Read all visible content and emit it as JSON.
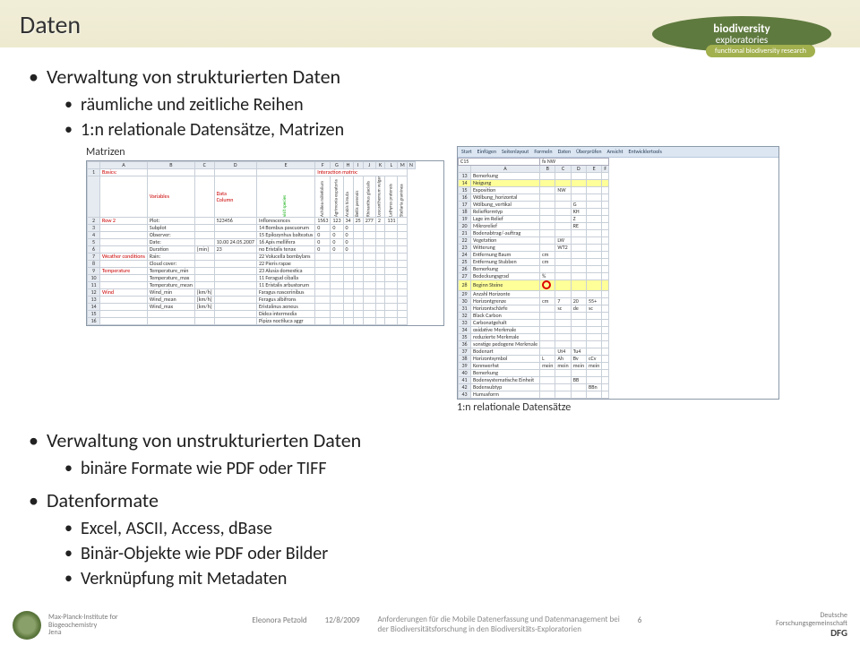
{
  "title": "Daten",
  "logo": {
    "line1": "biodiversity",
    "line2": "exploratories",
    "sub": "functional biodiversity research"
  },
  "bullets": {
    "b1": "Verwaltung von strukturierten Daten",
    "b1a": "räumliche und zeitliche Reihen",
    "b1b": "1:n relationale Datensätze, Matrizen",
    "b2": "Verwaltung von unstrukturierten Daten",
    "b2a": "binäre Formate wie PDF oder TIFF",
    "b3": "Datenformate",
    "b3a": "Excel, ASCII, Access, dBase",
    "b3b": "Binär-Objekte wie PDF oder Bilder",
    "b3c": "Verknüpfung mit Metadaten"
  },
  "fig1": {
    "caption": "Matrizen",
    "label_basics": "Basics:",
    "label_variables": "Variables",
    "label_data_col": "Data Column",
    "label_interaction": "Interaction matrix:",
    "side_label": "visit species",
    "rows_left": [
      "Row 2",
      "",
      "",
      "",
      "",
      "Weather conditions",
      "",
      "Temperature",
      "",
      "",
      "Wind",
      "",
      "",
      "",
      "",
      ""
    ],
    "col_a": [
      "Plot:",
      "Subplot",
      "Observer:",
      "Date:",
      "Duration",
      "Rain:",
      "Cloud cover:",
      "Temperature_min",
      "Temperature_max",
      "Temperature_mean",
      "Wind_min",
      "Wind_mean",
      "Wind_max",
      "",
      "",
      ""
    ],
    "col_b_units": [
      "",
      "",
      "",
      "",
      "[min]",
      "",
      "",
      "",
      "",
      "",
      "[km/h]",
      "[km/h]",
      "[km/h]",
      "",
      "",
      ""
    ],
    "col_c": [
      "523456",
      "",
      "",
      "10.00 24.05.2007",
      "23",
      "",
      "",
      "",
      "",
      "",
      "",
      "",
      "",
      "",
      "",
      ""
    ],
    "col_d_header": "Inflorescences",
    "species": [
      "Bombus pascuorum",
      "Epilozynhus balteatus",
      "Apis mellifera",
      "Eristalis tenax",
      "Volucella bombylans",
      "Pieris rapae",
      "Alusia domestica",
      "Feragud ciballa",
      "Eristalis arbustorum",
      "Faragus nascerinibus",
      "Feragus albifrons",
      "Eristalinus aeneus",
      "Didea intermedia",
      "Pipiza noctiluca aggr"
    ],
    "col_d_nums": [
      "14",
      "15",
      "16",
      "no",
      "22",
      "22",
      "23",
      "11",
      "11",
      "",
      "",
      "",
      "",
      ""
    ],
    "plant_cols": [
      "Achillea millefolium",
      "Agrimonia eupatoria",
      "Arabis hirsuta",
      "Bellis perennis",
      "Rhinanthus glacialis",
      "Leucanthemum vulgare",
      "Lathyrus pratensis",
      "Stellaria graminea"
    ],
    "plant_row_vals": [
      "1563",
      "123",
      "34",
      "25",
      "277",
      "2",
      "131",
      ""
    ]
  },
  "fig2": {
    "caption": "1:n relationale Datensätze",
    "ribbon": [
      "Start",
      "Einfügen",
      "Seitenlayout",
      "Formeln",
      "Daten",
      "Überprüfen",
      "Ansicht",
      "Entwicklertools"
    ],
    "cell_ref": "C15",
    "formula": "fx  NW",
    "cols": [
      "",
      "A",
      "B",
      "C",
      "D",
      "E",
      "F"
    ],
    "rows": [
      [
        "13",
        "Bemerkung",
        "",
        "",
        "",
        "",
        ""
      ],
      [
        "14",
        "Neigung",
        "",
        "",
        "",
        "",
        ""
      ],
      [
        "15",
        "Exposition",
        "",
        "NW",
        "",
        "",
        ""
      ],
      [
        "16",
        "Wölbung_horizontal",
        "",
        "",
        "",
        "",
        ""
      ],
      [
        "17",
        "Wölbung_vertikal",
        "",
        "",
        "G",
        "",
        ""
      ],
      [
        "18",
        "Reliefformtyp",
        "",
        "",
        "KH",
        "",
        ""
      ],
      [
        "19",
        "Lage im Relief",
        "",
        "",
        "Z",
        "",
        ""
      ],
      [
        "20",
        "Mikrorelief",
        "",
        "",
        "RE",
        "",
        ""
      ],
      [
        "21",
        "Bodenabtrag/-auftrag",
        "",
        "",
        "",
        "",
        ""
      ],
      [
        "22",
        "Vegetation",
        "",
        "LW",
        "",
        "",
        ""
      ],
      [
        "23",
        "Witterung",
        "",
        "WT2",
        "",
        "",
        ""
      ],
      [
        "24",
        "Entfernung Baum",
        "cm",
        "",
        "",
        "",
        ""
      ],
      [
        "25",
        "Entfernung Stubben",
        "cm",
        "",
        "",
        "",
        ""
      ],
      [
        "26",
        "Bemerkung",
        "",
        "",
        "",
        "",
        ""
      ],
      [
        "27",
        "Bedeckungsgrad",
        "%",
        "",
        "",
        "",
        ""
      ],
      [
        "28",
        "Beginn Steine",
        "",
        "",
        "",
        "",
        ""
      ],
      [
        "29",
        "Anzahl Horizonte",
        "",
        "",
        "",
        "",
        ""
      ],
      [
        "30",
        "Horizontgrenze",
        "cm",
        "7",
        "20",
        "55+",
        ""
      ],
      [
        "31",
        "Horizontschärfe",
        "",
        "sc",
        "de",
        "sc",
        ""
      ],
      [
        "32",
        "Black Carbon",
        "",
        "",
        "",
        "",
        ""
      ],
      [
        "33",
        "Carbonatgehalt",
        "",
        "",
        "",
        "",
        ""
      ],
      [
        "34",
        "oxidative Merkmale",
        "",
        "",
        "",
        "",
        ""
      ],
      [
        "35",
        "reduzierte Merkmale",
        "",
        "",
        "",
        "",
        ""
      ],
      [
        "36",
        "sonstige pedogene Merkmale",
        "",
        "",
        "",
        "",
        ""
      ],
      [
        "37",
        "Bodenart",
        "",
        "Ut4",
        "Tu4",
        "",
        ""
      ],
      [
        "38",
        "Horizontsymbol",
        "L",
        "Ah",
        "Bv",
        "cCv",
        ""
      ],
      [
        "39",
        "Kennwerhst",
        "mein",
        "mein",
        "mein",
        "mein",
        ""
      ],
      [
        "40",
        "Bemerkung",
        "",
        "",
        "",
        "",
        ""
      ],
      [
        "41",
        "Bodensystematische Einheit",
        "",
        "",
        "BB",
        "",
        ""
      ],
      [
        "42",
        "Bodensubtyp",
        "",
        "",
        "",
        "BBn",
        ""
      ],
      [
        "43",
        "Humusform",
        "",
        "",
        "",
        "",
        ""
      ]
    ],
    "yellow_rows": [
      "14",
      "28"
    ]
  },
  "footer": {
    "mpi": {
      "l1": "Max-Planck-Institute for",
      "l2": "Biogeochemistry",
      "l3": "Jena"
    },
    "author": "Eleonora Petzold",
    "date": "12/8/2009",
    "desc1": "Anforderungen für die Mobile Datenerfassung und Datenmanagement bei",
    "desc2": "der Biodiversitätsforschung in den Biodiversitäts-Exploratorien",
    "page": "6",
    "dfg1": "Deutsche",
    "dfg2": "Forschungsgemeinschaft",
    "dfg3": "DFG"
  }
}
